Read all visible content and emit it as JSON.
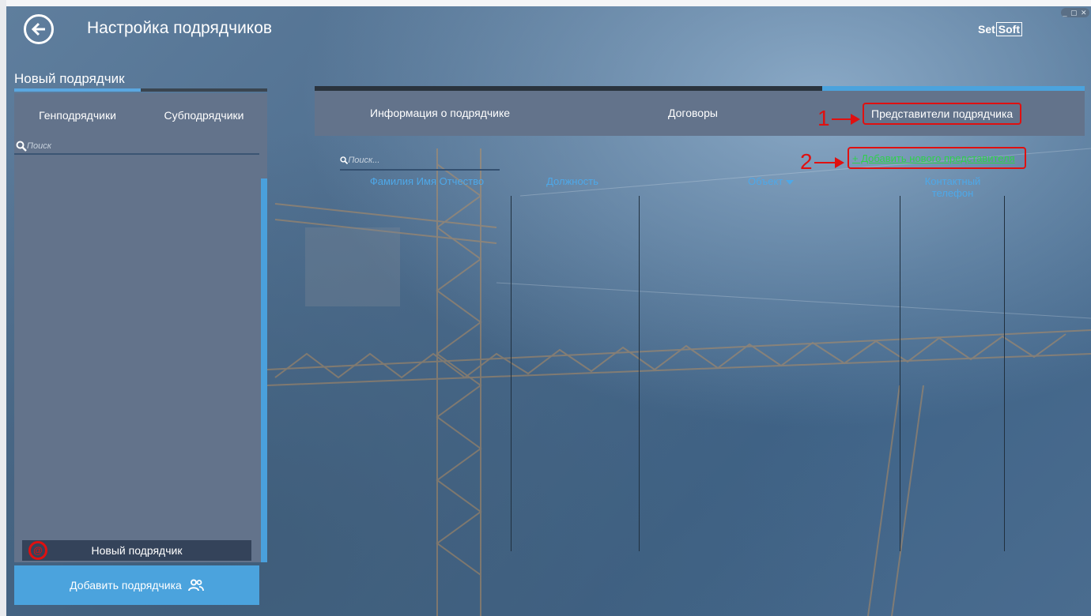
{
  "window": {
    "controls": "_ ▢ ✕"
  },
  "header": {
    "title": "Настройка подрядчиков",
    "back_icon": "arrow-left-circle-icon",
    "brand": {
      "prefix": "Set",
      "boxed": "Soft"
    }
  },
  "left": {
    "section_title": "Новый подрядчик",
    "tabs": [
      "Генподрядчики",
      "Субподрядчики"
    ],
    "search": {
      "placeholder": "Поиск",
      "value": ""
    },
    "items": [
      {
        "label": "Новый подрядчик",
        "icon": "new-contractor-icon",
        "icon_text": "@"
      }
    ],
    "add_button": {
      "label": "Добавить подрядчика",
      "icon": "users-icon"
    }
  },
  "right": {
    "tabs": [
      {
        "label": "Информация о подрядчике",
        "active": false
      },
      {
        "label": "Договоры",
        "active": false
      },
      {
        "label": "Представители подрядчика",
        "active": true
      }
    ],
    "search": {
      "placeholder": "Поиск...",
      "value": ""
    },
    "add_link": "+ Добавить нового представителя",
    "columns": [
      "Фамилия Имя Отчество",
      "Должность",
      "Объект",
      "Контактный телефон"
    ],
    "columns_wrapped": {
      "phone_line1": "Контактный",
      "phone_line2": "телефон"
    }
  },
  "annotations": [
    {
      "number": "1"
    },
    {
      "number": "2"
    }
  ],
  "colors": {
    "accent": "#4ba3dd",
    "annotation": "#e01010",
    "link": "#2fd14b",
    "panel": "#63738b",
    "column_header": "#4ea8e8"
  }
}
